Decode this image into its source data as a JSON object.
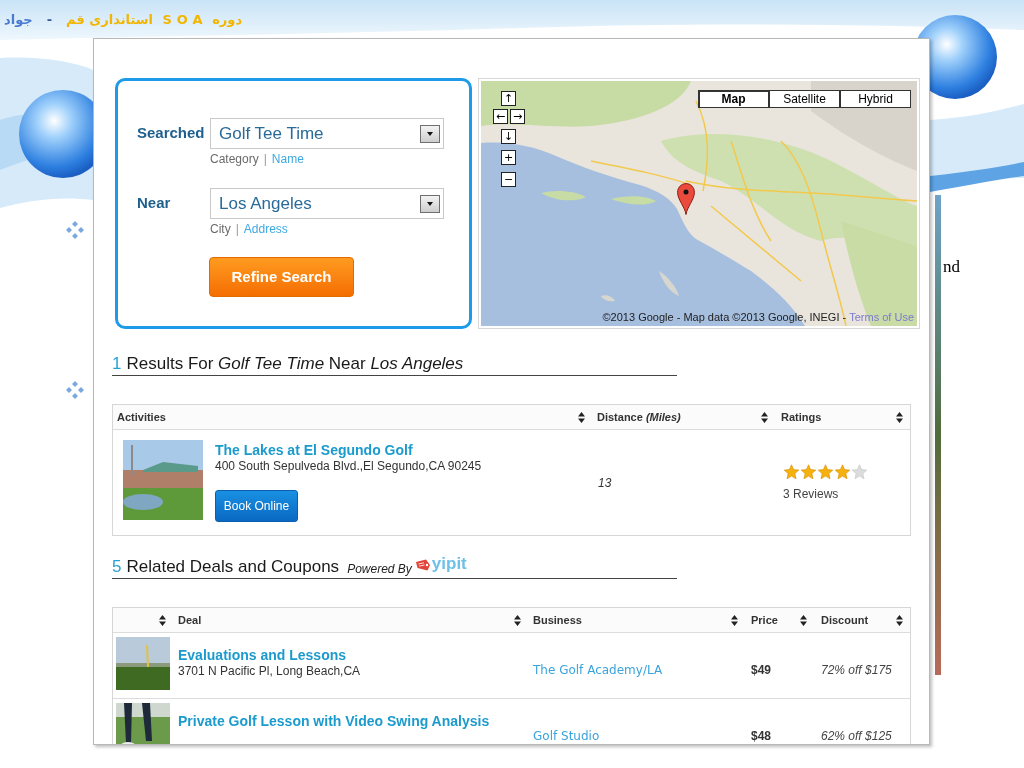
{
  "slide": {
    "title": "دوره SOA استانداری قم",
    "separator": "-",
    "author": "جواد",
    "body_fragment": "nd"
  },
  "search_form": {
    "fields": [
      {
        "label": "Searched",
        "value": "Golf Tee Time",
        "modes": [
          {
            "label": "Category",
            "selected": true
          },
          {
            "label": "Name",
            "selected": false
          }
        ],
        "mode_separator": "|"
      },
      {
        "label": "Near",
        "value": "Los Angeles",
        "modes": [
          {
            "label": "City",
            "selected": true
          },
          {
            "label": "Address",
            "selected": false
          }
        ],
        "mode_separator": "|"
      }
    ],
    "submit_button": "Refine Search"
  },
  "map": {
    "map_types": [
      {
        "label": "Map",
        "selected": true
      },
      {
        "label": "Satellite",
        "selected": false
      },
      {
        "label": "Hybrid",
        "selected": false
      }
    ],
    "pan_controls": [
      "↑",
      "←",
      "→",
      "↓"
    ],
    "zoom_controls": [
      "+",
      "−"
    ],
    "attribution": "©2013 Google - Map data ©2013 Google, INEGI -",
    "terms_link": "Terms of Use"
  },
  "results": {
    "count": "1",
    "heading": "Results For *Golf Tee Time* Near *Los Angeles*",
    "columns": [
      "Activities",
      "Distance *(Miles)*",
      "Ratings"
    ],
    "rows": [
      {
        "name": "The Lakes at El Segundo Golf",
        "address": "400 South Sepulveda Blvd.,El Segundo,CA 90245",
        "action": "Book Online",
        "distance": "13",
        "stars": 4,
        "reviews": "3 Reviews"
      }
    ]
  },
  "deals": {
    "count": "5",
    "heading": "Related Deals and Coupons",
    "powered_by": "Powered By",
    "brand": "yipit",
    "columns": [
      "Deal",
      "Business",
      "Price",
      "Discount"
    ],
    "rows": [
      {
        "title": "Evaluations and Lessons",
        "address": "3701 N Pacific Pl, Long Beach,CA",
        "business": "The Golf Academy/LA",
        "price": "$49",
        "discount": "72% off $175"
      },
      {
        "title": "Private Golf Lesson with Video Swing Analysis",
        "business": "Golf Studio",
        "price": "$48",
        "discount": "62% off $125"
      }
    ]
  }
}
